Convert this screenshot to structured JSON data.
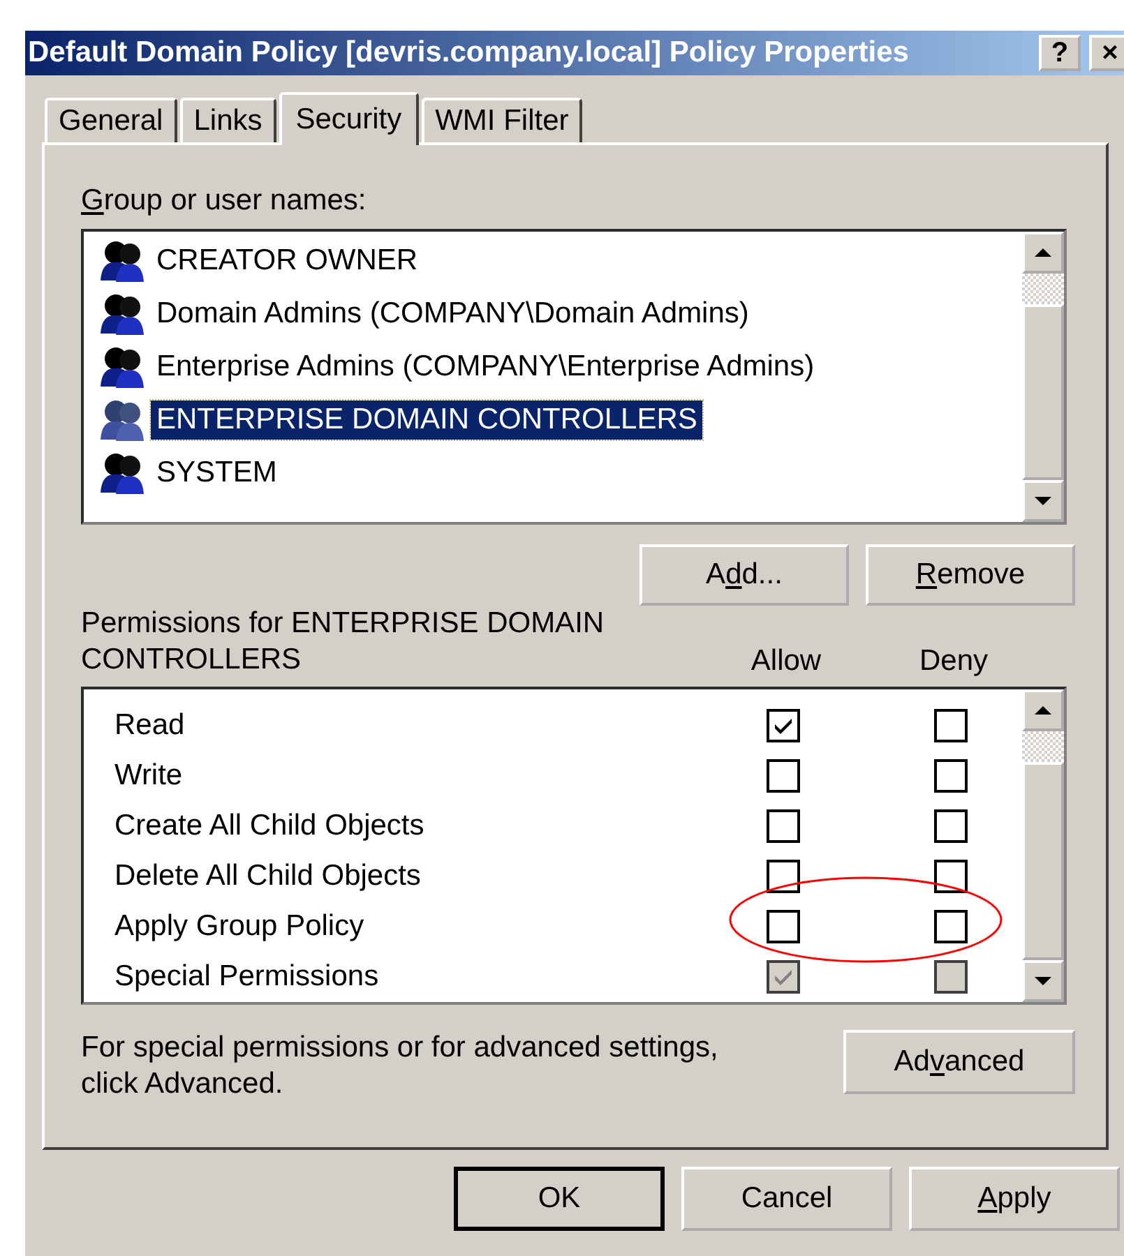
{
  "window": {
    "title": "Default Domain Policy [devris.company.local] Policy Properties",
    "title_buttons": [
      "?",
      "×"
    ]
  },
  "tabs": [
    {
      "label": "General",
      "selected": false
    },
    {
      "label": "Links",
      "selected": false
    },
    {
      "label": "Security",
      "selected": true
    },
    {
      "label": "WMI Filter",
      "selected": false
    }
  ],
  "group_list": {
    "label": {
      "access_key": "G",
      "after": "roup or user names:"
    },
    "items": [
      {
        "name": "CREATOR OWNER",
        "selected": false
      },
      {
        "name": "Domain Admins (COMPANY\\Domain Admins)",
        "selected": false
      },
      {
        "name": "Enterprise Admins (COMPANY\\Enterprise Admins)",
        "selected": false
      },
      {
        "name": "ENTERPRISE DOMAIN CONTROLLERS",
        "selected": true
      },
      {
        "name": "SYSTEM",
        "selected": false
      }
    ]
  },
  "group_buttons": [
    {
      "label": {
        "before": "A",
        "access_key": "d",
        "after": "d..."
      }
    },
    {
      "label": {
        "access_key": "R",
        "after": "emove"
      }
    }
  ],
  "permissions": {
    "label": "Permissions for ENTERPRISE DOMAIN CONTROLLERS",
    "columns": [
      "Allow",
      "Deny"
    ],
    "rows": [
      {
        "name": "Read",
        "allow": {
          "checked": true,
          "disabled": false
        },
        "deny": {
          "checked": false,
          "disabled": false
        }
      },
      {
        "name": "Write",
        "allow": {
          "checked": false,
          "disabled": false
        },
        "deny": {
          "checked": false,
          "disabled": false
        }
      },
      {
        "name": "Create All Child Objects",
        "allow": {
          "checked": false,
          "disabled": false
        },
        "deny": {
          "checked": false,
          "disabled": false
        }
      },
      {
        "name": "Delete All Child Objects",
        "allow": {
          "checked": false,
          "disabled": false
        },
        "deny": {
          "checked": false,
          "disabled": false
        }
      },
      {
        "name": "Apply Group Policy",
        "allow": {
          "checked": false,
          "disabled": false
        },
        "deny": {
          "checked": false,
          "disabled": false
        }
      },
      {
        "name": "Special Permissions",
        "allow": {
          "checked": true,
          "disabled": true
        },
        "deny": {
          "checked": false,
          "disabled": true
        }
      }
    ],
    "highlight": {
      "kind": "ellipse"
    }
  },
  "advanced": {
    "text": "For special permissions or for advanced settings, click Advanced.",
    "button": {
      "label": {
        "before": "Ad",
        "access_key": "v",
        "after": "anced"
      }
    }
  },
  "dialog_buttons": [
    {
      "label": {
        "before": "OK"
      },
      "default": true
    },
    {
      "label": {
        "before": "Cancel"
      },
      "default": false
    },
    {
      "label": {
        "access_key": "A",
        "after": "pply"
      },
      "default": false
    }
  ]
}
